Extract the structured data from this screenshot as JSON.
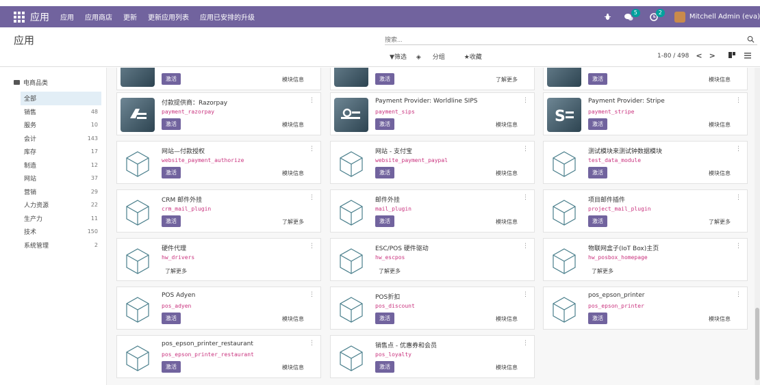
{
  "topbar": {
    "brand": "应用",
    "menu": [
      "应用",
      "应用商店",
      "更新",
      "更新应用列表",
      "应用已安排的升级"
    ],
    "chat_count": "5",
    "activity_count": "2",
    "user": "Mitchell Admin (eva)"
  },
  "control": {
    "title": "应用",
    "search_placeholder": "搜索...",
    "filter": "▼筛选",
    "group": "分组",
    "favorite": "★收藏",
    "pager": "1-80 / 498",
    "prev": "<",
    "next": ">"
  },
  "sidebar": {
    "heading": "电商品类",
    "items": [
      {
        "label": "全部",
        "count": ""
      },
      {
        "label": "销售",
        "count": "48"
      },
      {
        "label": "服务",
        "count": "10"
      },
      {
        "label": "会计",
        "count": "143"
      },
      {
        "label": "库存",
        "count": "17"
      },
      {
        "label": "制造",
        "count": "12"
      },
      {
        "label": "网站",
        "count": "37"
      },
      {
        "label": "营销",
        "count": "29"
      },
      {
        "label": "人力资源",
        "count": "22"
      },
      {
        "label": "生产力",
        "count": "11"
      },
      {
        "label": "技术",
        "count": "150"
      },
      {
        "label": "系统管理",
        "count": "2"
      }
    ]
  },
  "labels": {
    "activate": "激活",
    "module_info": "模块信息",
    "learn_more": "了解更多",
    "kebab": "⋮"
  },
  "top_partial": [
    {
      "action": "模块信息"
    },
    {
      "action": "了解更多"
    },
    {
      "action": "模块信息"
    }
  ],
  "cards": [
    {
      "name": "付款提供商：Razorpay",
      "tech": "payment_razorpay",
      "icon": "razorpay-icon",
      "activate": true,
      "action": "模块信息"
    },
    {
      "name": "Payment Provider: Worldline SIPS",
      "tech": "payment_sips",
      "icon": "worldline-icon",
      "activate": true,
      "action": "模块信息"
    },
    {
      "name": "Payment Provider: Stripe",
      "tech": "payment_stripe",
      "icon": "stripe-icon",
      "activate": true,
      "action": "模块信息"
    },
    {
      "name": "网站—付款授权",
      "tech": "website_payment_authorize",
      "icon": "module-cube-icon",
      "activate": true,
      "action": "模块信息"
    },
    {
      "name": "网站 - 支付宝",
      "tech": "website_payment_paypal",
      "icon": "module-cube-icon",
      "activate": true,
      "action": "模块信息"
    },
    {
      "name": "测试模块来测试钟数据模块",
      "tech": "test_data_module",
      "icon": "module-cube-icon",
      "activate": true,
      "action": "模块信息"
    },
    {
      "name": "CRM 邮件外挂",
      "tech": "crm_mail_plugin",
      "icon": "module-cube-icon",
      "activate": true,
      "action": "了解更多"
    },
    {
      "name": "邮件外挂",
      "tech": "mail_plugin",
      "icon": "module-cube-icon",
      "activate": true,
      "action": "模块信息"
    },
    {
      "name": "项目邮件插件",
      "tech": "project_mail_plugin",
      "icon": "module-cube-icon",
      "activate": true,
      "action": "了解更多"
    },
    {
      "name": "硬件代理",
      "tech": "hw_drivers",
      "icon": "module-cube-icon",
      "activate": false,
      "action": "了解更多"
    },
    {
      "name": "ESC/POS 硬件驱动",
      "tech": "hw_escpos",
      "icon": "module-cube-icon",
      "activate": false,
      "action": "了解更多"
    },
    {
      "name": "物联网盒子(IoT Box)主页",
      "tech": "hw_posbox_homepage",
      "icon": "module-cube-icon",
      "activate": false,
      "action": "了解更多"
    },
    {
      "name": "POS Adyen",
      "tech": "pos_adyen",
      "icon": "module-cube-icon",
      "activate": true,
      "action": "模块信息"
    },
    {
      "name": "POS折扣",
      "tech": "pos_discount",
      "icon": "module-cube-icon",
      "activate": true,
      "action": "模块信息"
    },
    {
      "name": "pos_epson_printer",
      "tech": "pos_epson_printer",
      "icon": "module-cube-icon",
      "activate": true,
      "action": "模块信息"
    },
    {
      "name": "pos_epson_printer_restaurant",
      "tech": "pos_epson_printer_restaurant",
      "icon": "module-cube-icon",
      "activate": true,
      "action": "模块信息"
    },
    {
      "name": "销售点 - 优惠券和会员",
      "tech": "pos_loyalty",
      "icon": "module-cube-icon",
      "activate": true,
      "action": "模块信息"
    }
  ]
}
